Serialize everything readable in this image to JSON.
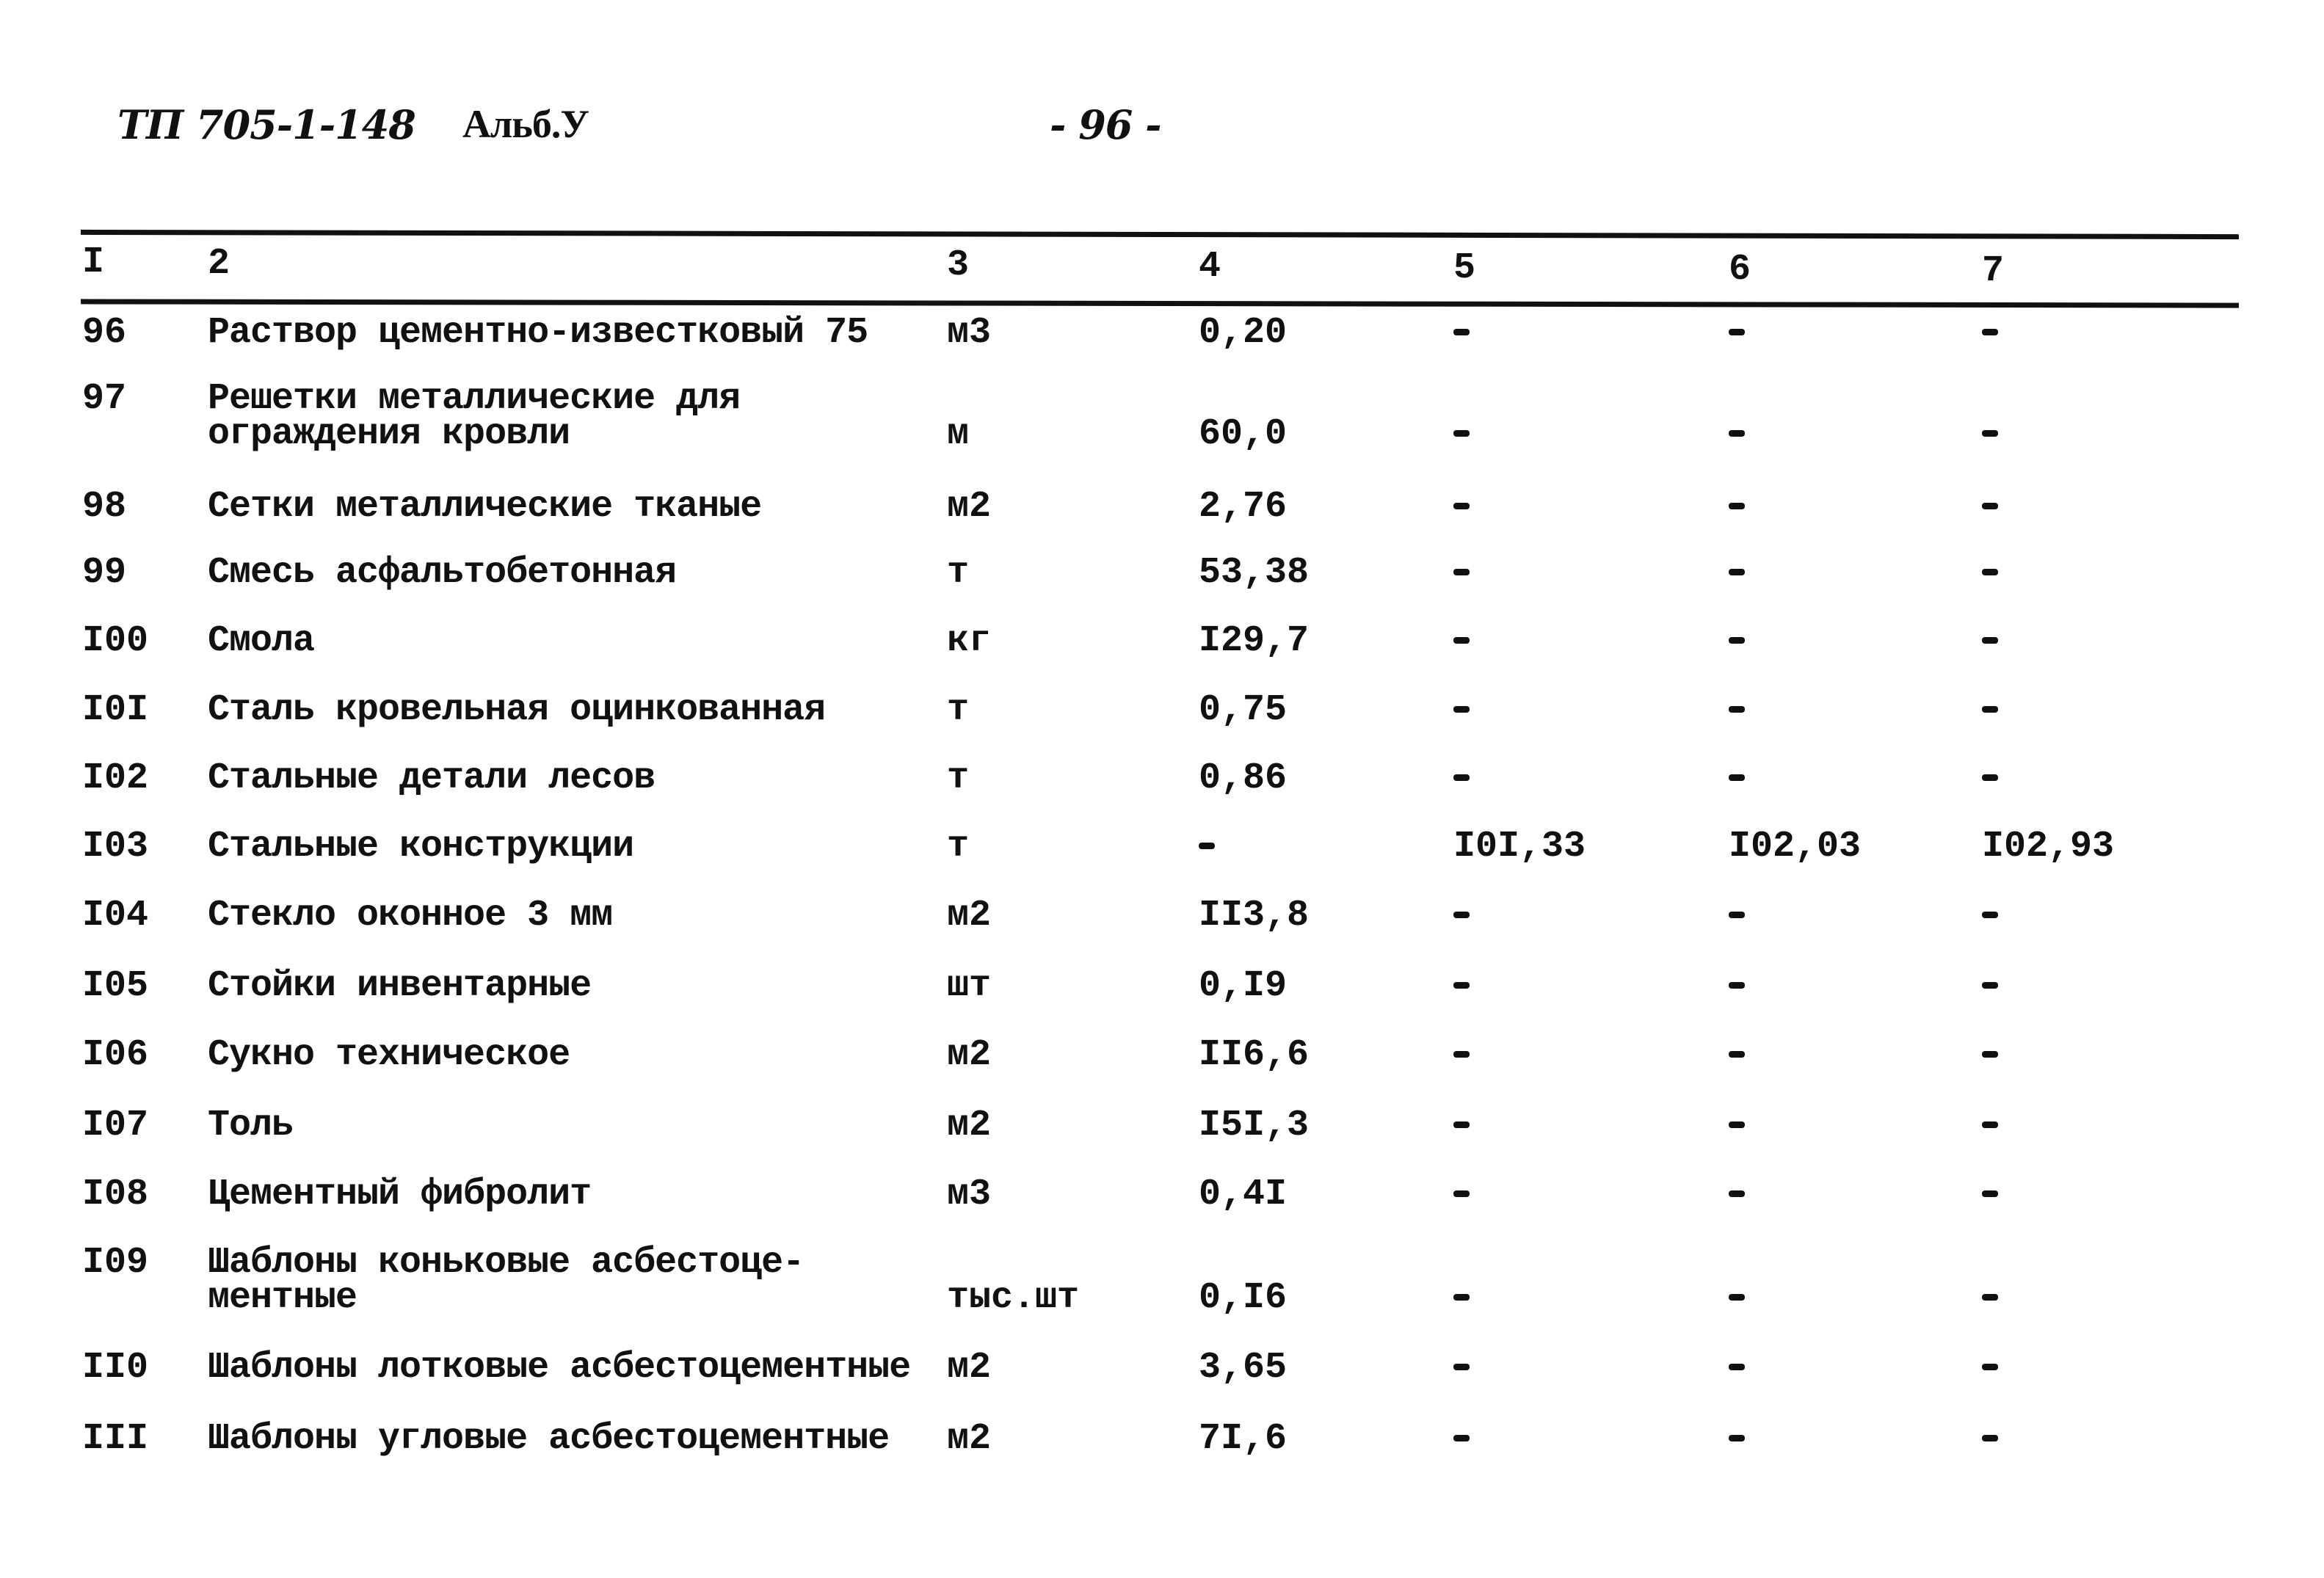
{
  "header": {
    "doc_code": "ТП 705-1-148",
    "album": "Альб.У",
    "page_number": "- 96 -"
  },
  "table": {
    "columns": [
      "I",
      "2",
      "3",
      "4",
      "5",
      "6",
      "7"
    ],
    "rows": [
      {
        "no": "96",
        "name": [
          "Раствор цементно-известковый 75"
        ],
        "unit": "м3",
        "c4": "0,20",
        "c5": "-",
        "c6": "-",
        "c7": "-"
      },
      {
        "no": "97",
        "name": [
          "Решетки металлические для",
          "ограждения кровли"
        ],
        "unit": "м",
        "c4": "60,0",
        "c5": "-",
        "c6": "-",
        "c7": "-"
      },
      {
        "no": "98",
        "name": [
          "Сетки металлические тканые"
        ],
        "unit": "м2",
        "c4": "2,76",
        "c5": "-",
        "c6": "-",
        "c7": "-"
      },
      {
        "no": "99",
        "name": [
          "Смесь асфальтобетонная"
        ],
        "unit": "т",
        "c4": "53,38",
        "c5": "-",
        "c6": "-",
        "c7": "-"
      },
      {
        "no": "I00",
        "name": [
          "Смола"
        ],
        "unit": "кг",
        "c4": "I29,7",
        "c5": "-",
        "c6": "-",
        "c7": "-"
      },
      {
        "no": "I0I",
        "name": [
          "Сталь кровельная оцинкованная"
        ],
        "unit": "т",
        "c4": "0,75",
        "c5": "-",
        "c6": "-",
        "c7": "-"
      },
      {
        "no": "I02",
        "name": [
          "Стальные детали лесов"
        ],
        "unit": "т",
        "c4": "0,86",
        "c5": "-",
        "c6": "-",
        "c7": "-"
      },
      {
        "no": "I03",
        "name": [
          "Стальные конструкции"
        ],
        "unit": "т",
        "c4": "-",
        "c5": "I0I,33",
        "c6": "I02,03",
        "c7": "I02,93"
      },
      {
        "no": "I04",
        "name": [
          "Стекло оконное 3 мм"
        ],
        "unit": "м2",
        "c4": "II3,8",
        "c5": "-",
        "c6": "-",
        "c7": "-"
      },
      {
        "no": "I05",
        "name": [
          "Стойки инвентарные"
        ],
        "unit": "шт",
        "c4": "0,I9",
        "c5": "-",
        "c6": "-",
        "c7": "-"
      },
      {
        "no": "I06",
        "name": [
          "Сукно техническое"
        ],
        "unit": "м2",
        "c4": "II6,6",
        "c5": "-",
        "c6": "-",
        "c7": "-"
      },
      {
        "no": "I07",
        "name": [
          "Толь"
        ],
        "unit": "м2",
        "c4": "I5I,3",
        "c5": "-",
        "c6": "-",
        "c7": "-"
      },
      {
        "no": "I08",
        "name": [
          "Цементный фибролит"
        ],
        "unit": "м3",
        "c4": "0,4I",
        "c5": "-",
        "c6": "-",
        "c7": "-"
      },
      {
        "no": "I09",
        "name": [
          "Шаблоны коньковые асбестоце-",
          "ментные"
        ],
        "unit": "тыс.шт",
        "c4": "0,I6",
        "c5": "-",
        "c6": "-",
        "c7": "-"
      },
      {
        "no": "II0",
        "name": [
          "Шаблоны лотковые асбестоцементные"
        ],
        "unit": "м2",
        "c4": "3,65",
        "c5": "-",
        "c6": "-",
        "c7": "-"
      },
      {
        "no": "III",
        "name": [
          "Шаблоны угловые асбестоцементные"
        ],
        "unit": "м2",
        "c4": "7I,6",
        "c5": "-",
        "c6": "-",
        "c7": "-"
      }
    ]
  }
}
